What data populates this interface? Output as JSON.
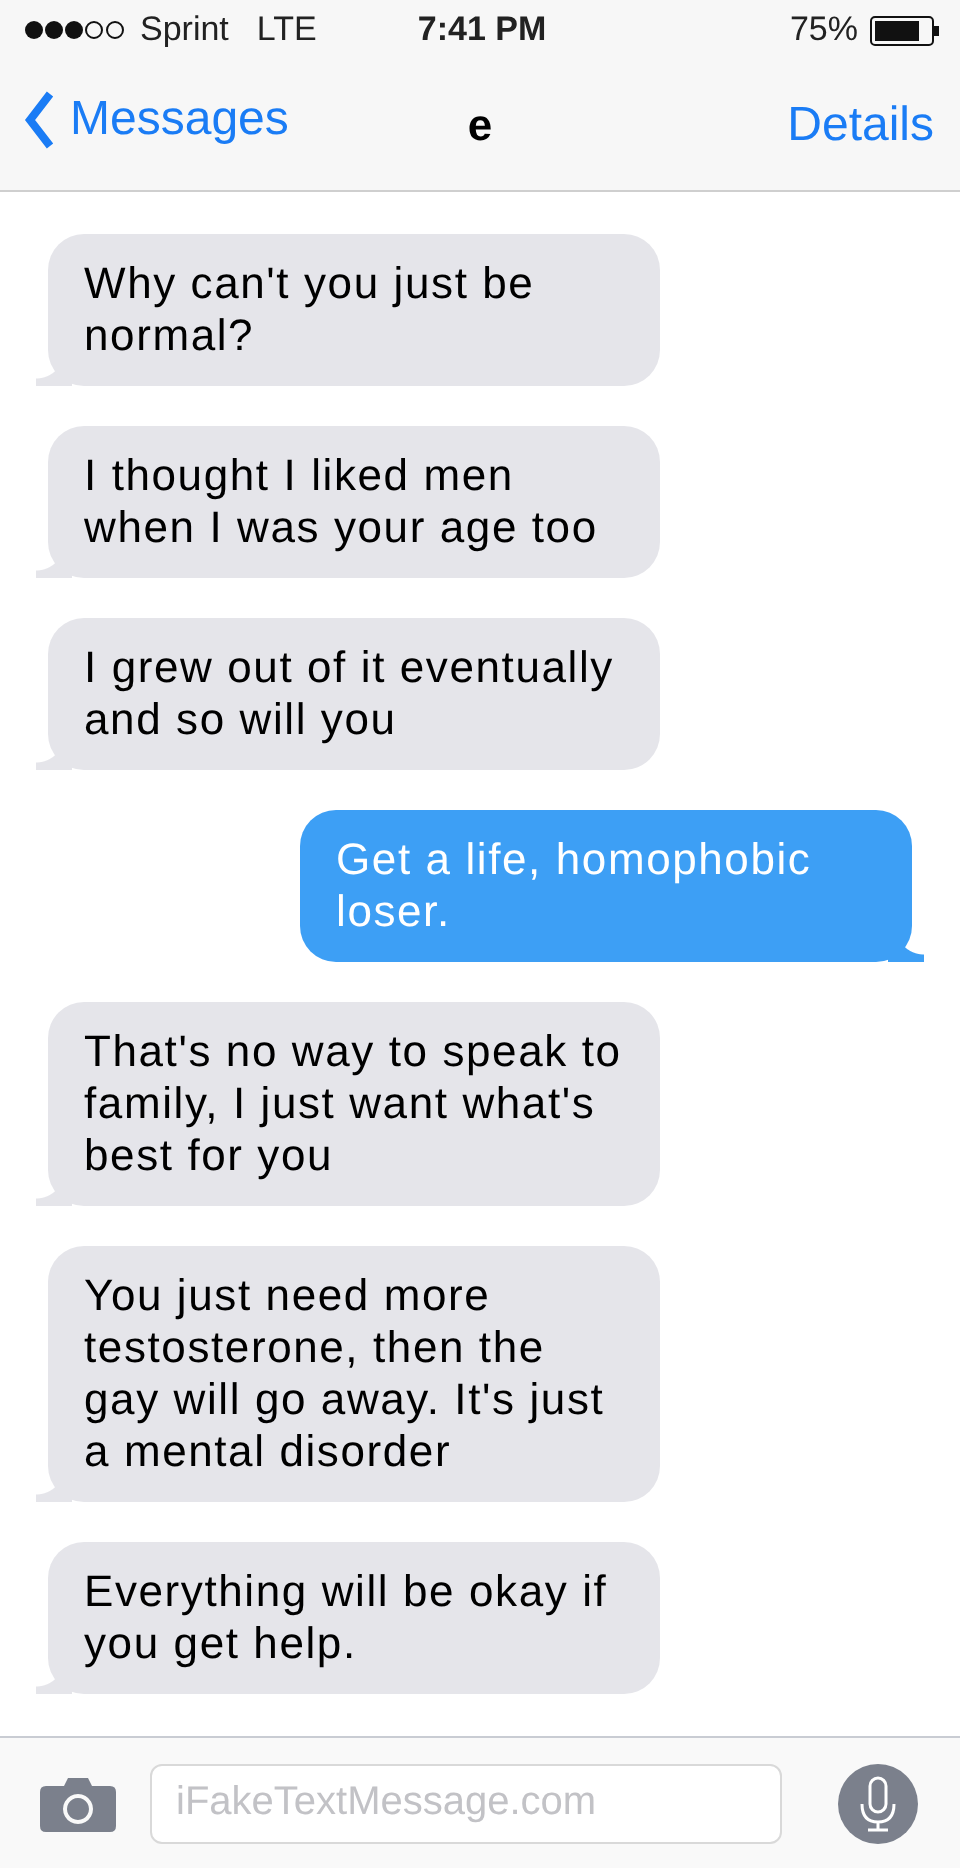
{
  "status_bar": {
    "carrier": "Sprint",
    "network": "LTE",
    "time": "7:41 PM",
    "battery": "75%"
  },
  "nav_bar": {
    "back": "Messages",
    "title": "e",
    "action": "Details"
  },
  "messages": [
    {
      "kind": "received",
      "text": "Why can't you just be normal?"
    },
    {
      "kind": "received",
      "text": "I thought I liked men when I was your age too"
    },
    {
      "kind": "received",
      "text": "I grew out of it eventually and so will you"
    },
    {
      "kind": "sent",
      "text": "Get a life, homophobic loser."
    },
    {
      "kind": "received",
      "text": "That's no way to speak to family, I just want what's best for you"
    },
    {
      "kind": "received",
      "text": "You just need more testosterone, then the gay will go away. It's just a mental disorder"
    },
    {
      "kind": "received",
      "text": "Everything will be okay if you get help."
    }
  ],
  "compose": {
    "placeholder": "iFakeTextMessage.com"
  }
}
